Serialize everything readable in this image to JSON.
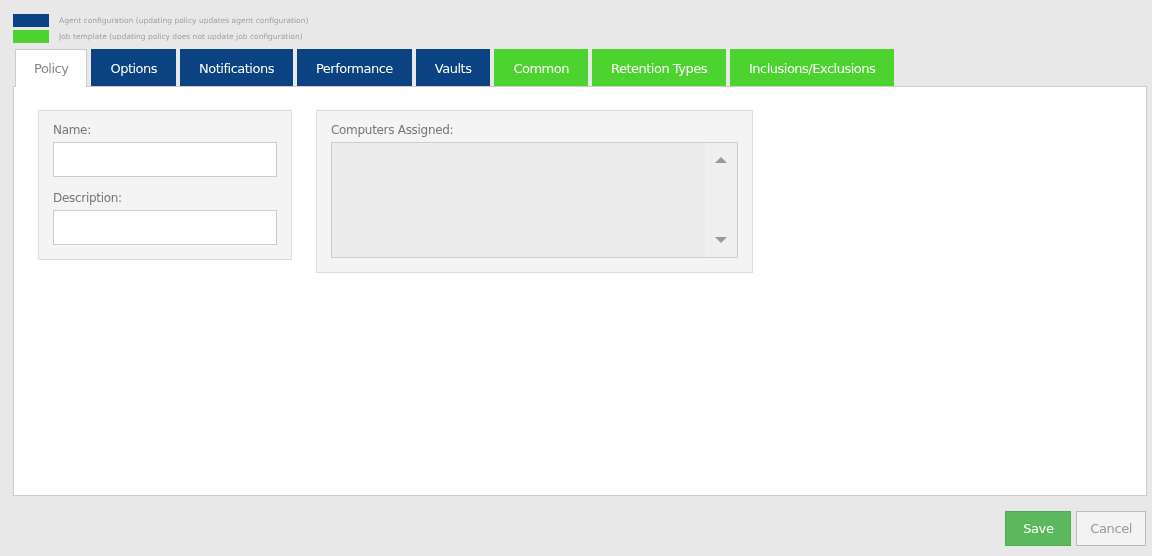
{
  "legend": [
    {
      "color": "#0b4382",
      "label": "Agent configuration (updating policy updates agent configuration)"
    },
    {
      "color": "#4cd32f",
      "label": "Job template (updating policy does not update job configuration)"
    }
  ],
  "tabs": [
    {
      "label": "Policy",
      "kind": "general",
      "selected": true
    },
    {
      "label": "Options",
      "kind": "agent",
      "selected": false
    },
    {
      "label": "Notifications",
      "kind": "agent",
      "selected": false
    },
    {
      "label": "Performance",
      "kind": "agent",
      "selected": false
    },
    {
      "label": "Vaults",
      "kind": "agent",
      "selected": false
    },
    {
      "label": "Common",
      "kind": "job",
      "selected": false
    },
    {
      "label": "Retention Types",
      "kind": "job",
      "selected": false
    },
    {
      "label": "Inclusions/Exclusions",
      "kind": "job",
      "selected": false
    }
  ],
  "fields": [
    {
      "label": "Name:"
    },
    {
      "label": "Description:"
    }
  ],
  "computers": {
    "label": "Computers Assigned:"
  },
  "buttons": [
    {
      "label": "Save",
      "kind": "primary"
    },
    {
      "label": "Cancel",
      "kind": "secondary"
    }
  ]
}
